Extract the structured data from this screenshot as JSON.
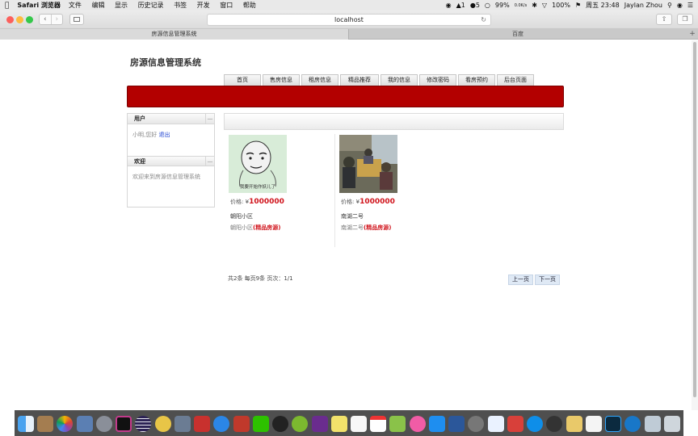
{
  "menubar": {
    "app_name": "Safari 浏览器",
    "items": [
      "文件",
      "编辑",
      "显示",
      "历史记录",
      "书签",
      "开发",
      "窗口",
      "帮助"
    ],
    "status": {
      "notif1": "1",
      "notif2": "5",
      "cpu": "99%",
      "net": "0.0K/s",
      "battery": "100%",
      "datetime": "周五 23:48",
      "user": "Jaylan Zhou"
    }
  },
  "browser": {
    "url": "localhost",
    "tabs": [
      {
        "label": "房源信息管理系统",
        "active": true
      },
      {
        "label": "百度",
        "active": false
      }
    ]
  },
  "site": {
    "title": "房源信息管理系统",
    "nav": [
      "首页",
      "售房信息",
      "租房信息",
      "精品推荐",
      "我的信息",
      "修改密码",
      "看房预约",
      "后台页面"
    ]
  },
  "sidebar": {
    "user_box": {
      "title": "用户",
      "greeting": "小明,您好",
      "logout": "退出"
    },
    "welcome_box": {
      "title": "欢迎",
      "text": "欢迎来到房源信息管理系统"
    }
  },
  "listings": [
    {
      "price_label": "价格:",
      "currency": "¥",
      "price": "1000000",
      "name": "朝阳小区",
      "desc": "朝阳小区",
      "tag": "(精品房源)",
      "image_caption": "我要开始作妖儿了"
    },
    {
      "price_label": "价格:",
      "currency": "¥",
      "price": "1000000",
      "name": "南湖二号",
      "desc": "南湖二号",
      "tag": "(精品房源)"
    }
  ],
  "pager": {
    "info": "共2条 每页9条 页次：1/1",
    "prev": "上一页",
    "next": "下一页"
  },
  "colors": {
    "banner": "#b30000",
    "price": "#d0141c",
    "link": "#1a3fd0"
  }
}
